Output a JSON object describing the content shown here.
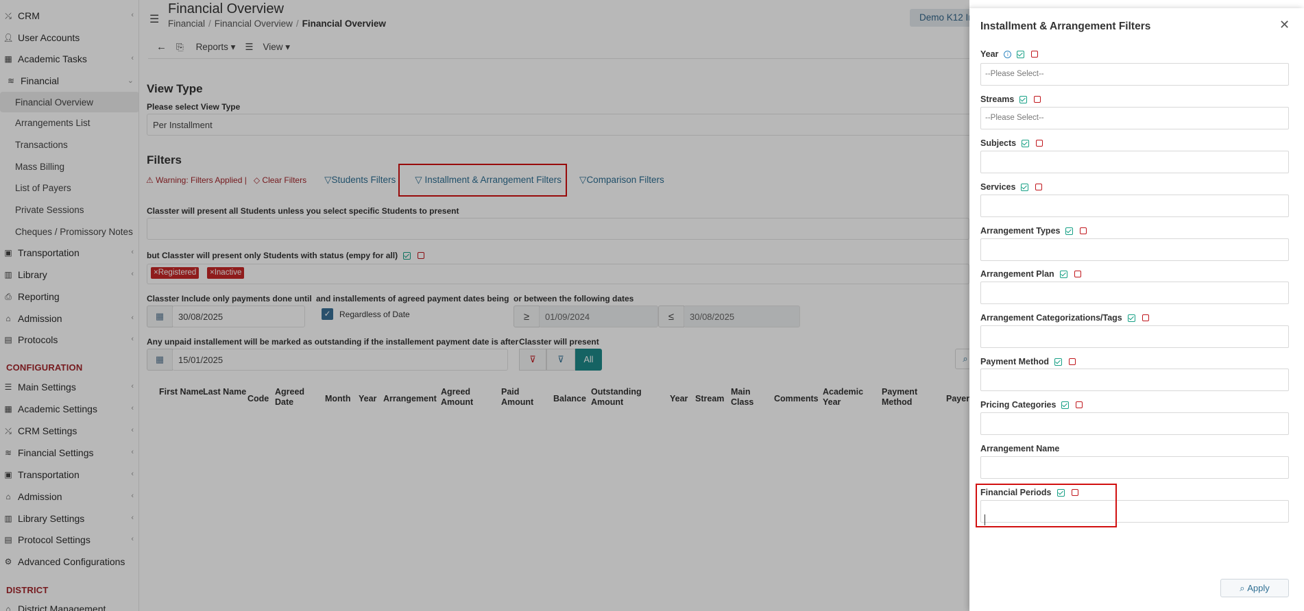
{
  "sidebar": {
    "items": [
      {
        "label": "CRM",
        "icon": "crm-icon",
        "chevron": true
      },
      {
        "label": "User Accounts",
        "icon": "user-icon",
        "chevron": false
      },
      {
        "label": "Academic Tasks",
        "icon": "grid-icon",
        "chevron": true
      },
      {
        "label": "Financial",
        "icon": "coins-icon",
        "chevron": true
      }
    ],
    "financial_subitems": [
      "Financial Overview",
      "Arrangements List",
      "Transactions",
      "Mass Billing",
      "List of Payers",
      "Private Sessions",
      "Cheques / Promissory Notes"
    ],
    "items2": [
      {
        "label": "Transportation",
        "icon": "bus-icon",
        "chevron": true
      },
      {
        "label": "Library",
        "icon": "books-icon",
        "chevron": true
      },
      {
        "label": "Reporting",
        "icon": "printer-icon",
        "chevron": false
      },
      {
        "label": "Admission",
        "icon": "bank-icon",
        "chevron": true
      },
      {
        "label": "Protocols",
        "icon": "folder-icon",
        "chevron": true
      }
    ],
    "config_heading": "CONFIGURATION",
    "config_items": [
      {
        "label": "Main Settings",
        "icon": "sliders-icon",
        "chevron": true
      },
      {
        "label": "Academic Settings",
        "icon": "grid-icon",
        "chevron": true
      },
      {
        "label": "CRM Settings",
        "icon": "crm-icon",
        "chevron": true
      },
      {
        "label": "Financial Settings",
        "icon": "coins-icon",
        "chevron": true
      },
      {
        "label": "Transportation",
        "icon": "bus-icon",
        "chevron": true
      },
      {
        "label": "Admission",
        "icon": "bank-icon",
        "chevron": true
      },
      {
        "label": "Library Settings",
        "icon": "books-icon",
        "chevron": true
      },
      {
        "label": "Protocol Settings",
        "icon": "folder-icon",
        "chevron": true
      },
      {
        "label": "Advanced Configurations",
        "icon": "gears-icon",
        "chevron": false
      }
    ],
    "district_heading": "DISTRICT",
    "district_item": "District Management"
  },
  "header": {
    "title": "Financial Overview",
    "breadcrumb": [
      "Financial",
      "Financial Overview",
      "Financial Overview"
    ],
    "demo_label": "Demo K12 In",
    "reports_label": "Reports",
    "view_label": "View"
  },
  "view_type": {
    "heading": "View Type",
    "label": "Please select View Type",
    "value": "Per Installment"
  },
  "filters": {
    "heading": "Filters",
    "warning": "Warning: Filters Applied",
    "clear": "Clear Filters",
    "students": "Students Filters",
    "installment": "Installment & Arrangement Filters",
    "comparison": "Comparison Filters",
    "present_all_text": "Classter will present all Students unless you select specific Students to present",
    "status_text": "but Classter will present only Students with status (empy for all)",
    "status_tags": [
      "Registered",
      "Inactive"
    ],
    "payments_until_label": "Classter Include only payments done until",
    "payments_until_value": "30/08/2025",
    "agreed_dates_label": "and installements of agreed payment dates being",
    "regardless_label": "Regardless of Date",
    "between_label": "or between the following dates",
    "from_op": "≥",
    "from_value": "01/09/2024",
    "to_op": "≤",
    "to_value": "30/08/2025",
    "outstanding_label": "Any unpaid installement will be marked as outstanding if the installement payment date is after",
    "outstanding_value": "15/01/2025",
    "present_label": "Classter will present",
    "present_all_btn": "All"
  },
  "table": {
    "columns": [
      "First Name",
      "Last Name",
      "Code",
      "Agreed Date",
      "Month",
      "Year",
      "Arrangement",
      "Agreed Amount",
      "Paid Amount",
      "Balance",
      "Outstanding Amount",
      "Year",
      "Stream",
      "Main Class",
      "Comments",
      "Academic Year",
      "Payment Method",
      "Payer"
    ]
  },
  "panel": {
    "title": "Installment & Arrangement Filters",
    "fields": [
      {
        "label": "Year",
        "placeholder": "--Please Select--"
      },
      {
        "label": "Streams",
        "placeholder": "--Please Select--"
      },
      {
        "label": "Subjects",
        "placeholder": ""
      },
      {
        "label": "Services",
        "placeholder": ""
      },
      {
        "label": "Arrangement Types",
        "placeholder": ""
      },
      {
        "label": "Arrangement Plan",
        "placeholder": ""
      },
      {
        "label": "Arrangement Categorizations/Tags",
        "placeholder": ""
      },
      {
        "label": "Payment Method",
        "placeholder": ""
      },
      {
        "label": "Pricing Categories",
        "placeholder": ""
      },
      {
        "label": "Arrangement Name",
        "placeholder": ""
      },
      {
        "label": "Financial Periods",
        "placeholder": ""
      }
    ],
    "apply_label": "Apply"
  },
  "colors": {
    "accent": "#2f6f93",
    "danger": "#c62828",
    "teal": "#16a085",
    "highlight": "#d10f0f"
  }
}
